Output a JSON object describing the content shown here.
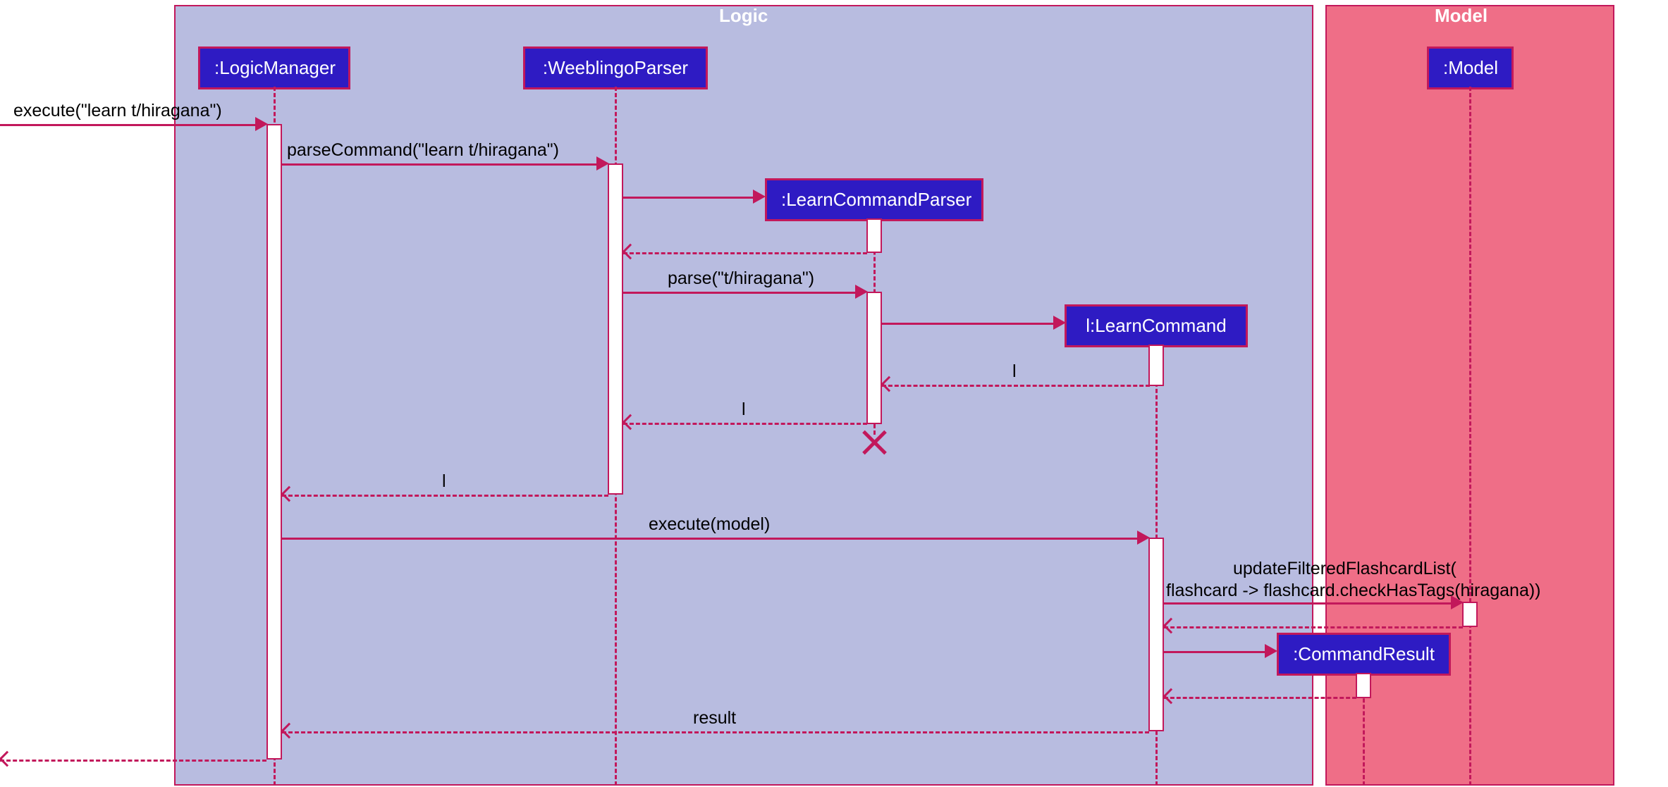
{
  "frames": {
    "logic": "Logic",
    "model": "Model"
  },
  "participants": {
    "logic_manager": ":LogicManager",
    "weeblingo_parser": ":WeeblingoParser",
    "learn_command_parser": ":LearnCommandParser",
    "learn_command": "l:LearnCommand",
    "command_result": ":CommandResult",
    "model": ":Model"
  },
  "messages": {
    "execute_in": "execute(\"learn t/hiragana\")",
    "parse_command": "parseCommand(\"learn t/hiragana\")",
    "parse": "parse(\"t/hiragana\")",
    "ret_l_1": "l",
    "ret_l_2": "l",
    "ret_l_3": "l",
    "execute_model": "execute(model)",
    "update_filtered_1": "updateFilteredFlashcardList(",
    "update_filtered_2": "flashcard -> flashcard.checkHasTags(hiragana))",
    "result": "result"
  }
}
